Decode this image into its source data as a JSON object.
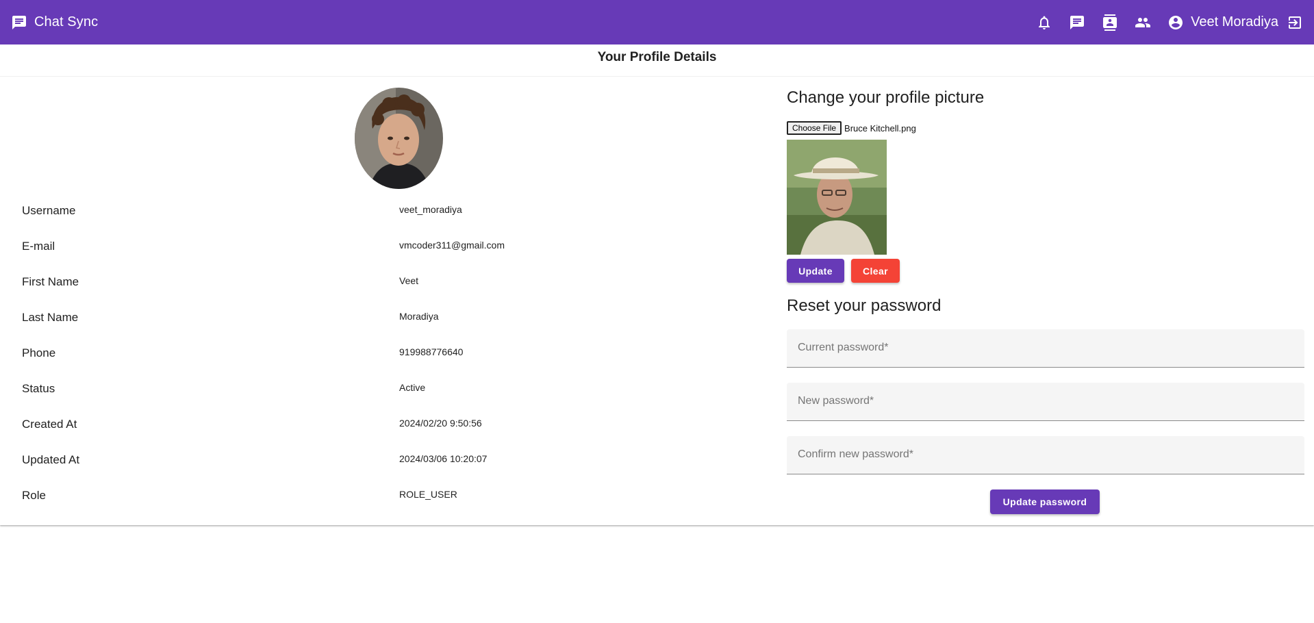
{
  "app": {
    "title": "Chat Sync"
  },
  "header": {
    "user_name": "Veet Moradiya",
    "icons": [
      "notifications-icon",
      "chat-icon",
      "contacts-icon",
      "groups-icon",
      "account-circle-icon",
      "logout-icon"
    ]
  },
  "profile": {
    "title": "Your Profile Details",
    "fields": [
      {
        "label": "Username",
        "value": "veet_moradiya"
      },
      {
        "label": "E-mail",
        "value": "vmcoder311@gmail.com"
      },
      {
        "label": "First Name",
        "value": "Veet"
      },
      {
        "label": "Last Name",
        "value": "Moradiya"
      },
      {
        "label": "Phone",
        "value": "919988776640"
      },
      {
        "label": "Status",
        "value": "Active"
      },
      {
        "label": "Created At",
        "value": "2024/02/20 9:50:56"
      },
      {
        "label": "Updated At",
        "value": "2024/03/06 10:20:07"
      },
      {
        "label": "Role",
        "value": "ROLE_USER"
      }
    ]
  },
  "picture": {
    "heading": "Change your profile picture",
    "choose_label": "Choose File",
    "file_name": "Bruce Kitchell.png",
    "update_label": "Update",
    "clear_label": "Clear"
  },
  "password": {
    "heading": "Reset your password",
    "current": "Current password*",
    "new": "New password*",
    "confirm": "Confirm new password*",
    "submit_label": "Update password"
  },
  "colors": {
    "primary": "#673ab7",
    "warn": "#f44336"
  }
}
